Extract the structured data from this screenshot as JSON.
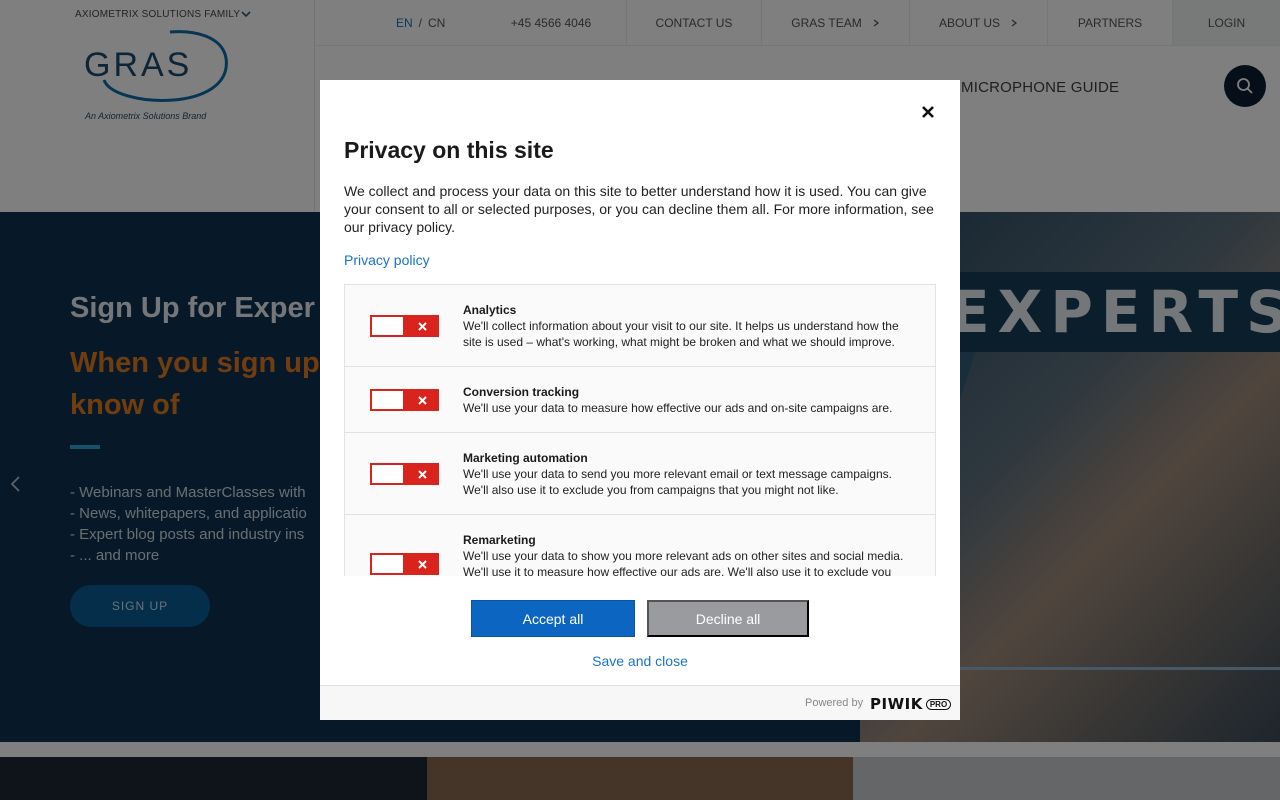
{
  "header": {
    "family_label": "AXIOMETRIX SOLUTIONS FAMILY",
    "lang_en": "EN",
    "lang_sep": "/",
    "lang_cn": "CN",
    "phone": "+45 4566 4046",
    "contact": "CONTACT US",
    "team": "GRAS TEAM",
    "about": "ABOUT US",
    "partners": "PARTNERS",
    "login": "LOGIN",
    "logo_text": "GRAS",
    "logo_tagline": "An Axiometrix Solutions Brand",
    "nav_microphone_guide": "MICROPHONE GUIDE"
  },
  "hero": {
    "title": "Sign Up for Exper",
    "subtitle": "When you sign up know of",
    "list": [
      "- Webinars and MasterClasses with",
      "- News, whitepapers, and applicatio",
      "- Expert blog posts and industry ins",
      "- ... and more"
    ],
    "signup_label": "SIGN UP",
    "banner_word": "EXPERTS"
  },
  "modal": {
    "title": "Privacy on this site",
    "description": "We collect and process your data on this site to better understand how it is used. You can give your consent to all or selected purposes, or you can decline them all. For more information, see our privacy policy.",
    "privacy_link": "Privacy policy",
    "purposes": [
      {
        "title": "Analytics",
        "description": "We'll collect information about your visit to our site. It helps us understand how the site is used – what's working, what might be broken and what we should improve.",
        "enabled": false
      },
      {
        "title": "Conversion tracking",
        "description": "We'll use your data to measure how effective our ads and on-site campaigns are.",
        "enabled": false
      },
      {
        "title": "Marketing automation",
        "description": "We'll use your data to send you more relevant email or text message campaigns. We'll also use it to exclude you from campaigns that you might not like.",
        "enabled": false
      },
      {
        "title": "Remarketing",
        "description": "We'll use your data to show you more relevant ads on other sites and social media. We'll use it to measure how effective our ads are. We'll also use it to exclude you",
        "enabled": false
      }
    ],
    "accept_all": "Accept all",
    "decline_all": "Decline all",
    "save_close": "Save and close",
    "powered_by": "Powered by",
    "brand_word": "PIWIK",
    "brand_pro": "PRO"
  },
  "colors": {
    "accent_blue": "#0c66c1",
    "toggle_red": "#d9231d",
    "hero_bg": "#0e3350",
    "hero_orange": "#e07a1f"
  }
}
